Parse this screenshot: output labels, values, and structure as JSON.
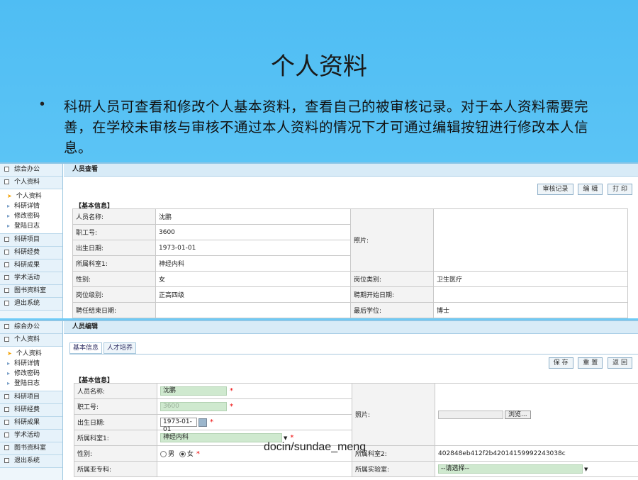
{
  "slide": {
    "title": "个人资料",
    "bullet": "科研人员可查看和修改个人基本资料，查看自己的被审核记录。对于本人资料需要完善，在学校未审核与审核不通过本人资料的情况下才可通过编辑按钮进行修改本人信息。"
  },
  "watermark": "docin/sundae_meng",
  "sidebar": {
    "items_top": [
      "综合办公",
      "个人资料"
    ],
    "sub_items": [
      "个人资料",
      "科研详情",
      "修改密码",
      "登陆日志"
    ],
    "items_bottom": [
      "科研项目",
      "科研经费",
      "科研成果",
      "学术活动",
      "图书资料室",
      "退出系统"
    ]
  },
  "view_panel": {
    "title": "人员查看",
    "buttons": [
      "审核记录",
      "编 辑",
      "打 印"
    ],
    "section": "【基本信息】",
    "rows": [
      {
        "label": "人员名称:",
        "value": "沈鹏"
      },
      {
        "label": "职工号:",
        "value": "3600"
      },
      {
        "label": "出生日期:",
        "value": "1973-01-01"
      },
      {
        "label": "所属科室1:",
        "value": "神经内科"
      }
    ],
    "photo_label": "照片:",
    "pair_rows": [
      {
        "l1": "性别:",
        "v1": "女",
        "l2": "岗位类别:",
        "v2": "卫生医疗"
      },
      {
        "l1": "岗位级别:",
        "v1": "正高四级",
        "l2": "聘期开始日期:",
        "v2": ""
      },
      {
        "l1": "聘任结束日期:",
        "v1": "",
        "l2": "最后学位:",
        "v2": "博士"
      }
    ]
  },
  "edit_panel": {
    "title": "人员编辑",
    "tabs": [
      "基本信息",
      "人才培养"
    ],
    "buttons": [
      "保 存",
      "重 置",
      "返 回"
    ],
    "section": "【基本信息】",
    "name_label": "人员名称:",
    "name_value": "沈鹏",
    "id_label": "职工号:",
    "id_value": "3600",
    "dob_label": "出生日期:",
    "dob_value": "1973-01-01",
    "dept_label": "所属科室1:",
    "dept_value": "神经内科",
    "photo_label": "照片:",
    "browse_label": "浏览...",
    "gender_label": "性别:",
    "gender_male": "男",
    "gender_female": "女",
    "dept2_label": "所属科室2:",
    "dept2_value": "402848eb412f2b42014159992243038c",
    "subspec_label": "所属亚专科:",
    "lab_label": "所属实验室:",
    "lab_value": "--请选择--",
    "required_mark": "*"
  }
}
